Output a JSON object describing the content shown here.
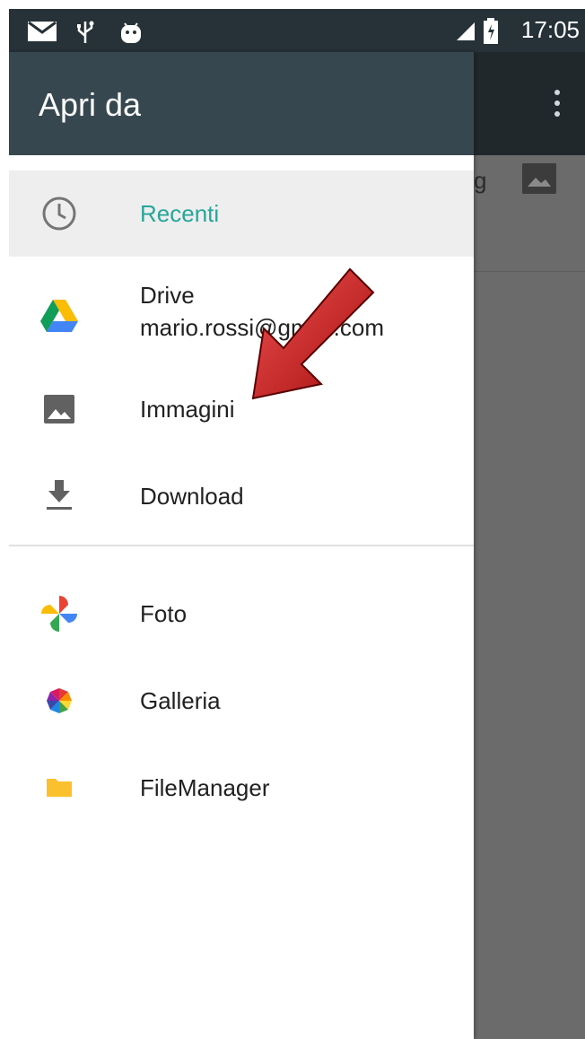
{
  "status_bar": {
    "time": "17:05",
    "icons": [
      "mail-icon",
      "usb-icon",
      "android-debug-icon",
      "signal-icon",
      "battery-icon"
    ]
  },
  "drawer": {
    "title": "Apri da",
    "items": [
      {
        "label": "Recenti",
        "icon": "clock-icon",
        "selected": true
      },
      {
        "label": "Drive",
        "sublabel": "mario.rossi@gmail.com",
        "icon": "google-drive-icon"
      },
      {
        "label": "Immagini",
        "icon": "image-icon"
      },
      {
        "label": "Download",
        "icon": "download-icon"
      },
      {
        "label": "Foto",
        "icon": "google-photos-icon"
      },
      {
        "label": "Galleria",
        "icon": "gallery-icon"
      },
      {
        "label": "FileManager",
        "icon": "folder-icon"
      }
    ]
  },
  "background": {
    "fragment": "g"
  },
  "colors": {
    "status_bar": "#263238",
    "drawer_header": "#37474f",
    "accent": "#26a69a",
    "scrim": "#6b6b6b",
    "arrow": "#d21f1f"
  }
}
